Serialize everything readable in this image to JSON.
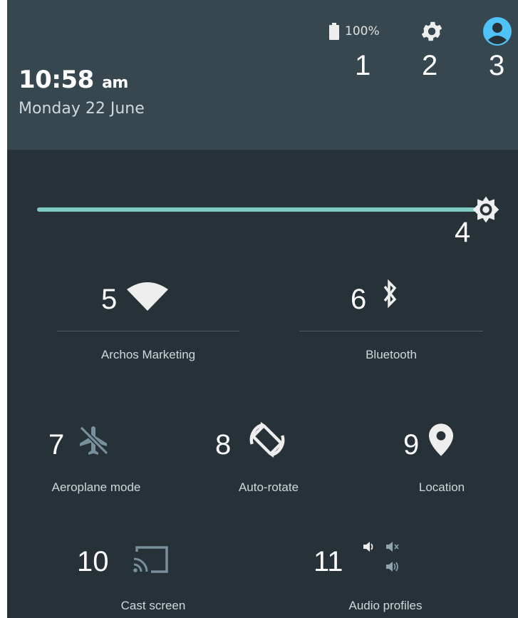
{
  "status": {
    "time": "10:58",
    "ampm": "am",
    "date": "Monday 22 June",
    "battery_percent": "100%"
  },
  "brightness": {
    "level": 1.0
  },
  "tiles": [
    {
      "label": "Archos Marketing",
      "icon": "wifi-icon"
    },
    {
      "label": "Bluetooth",
      "icon": "bluetooth-icon"
    },
    {
      "label": "Aeroplane mode",
      "icon": "airplane-icon"
    },
    {
      "label": "Auto-rotate",
      "icon": "rotate-icon"
    },
    {
      "label": "Location",
      "icon": "location-pin-icon"
    },
    {
      "label": "Cast screen",
      "icon": "cast-icon"
    },
    {
      "label": "Audio profiles",
      "icon": "speaker-icon"
    }
  ],
  "callouts": [
    "1",
    "2",
    "3",
    "4",
    "5",
    "6",
    "7",
    "8",
    "9",
    "10",
    "11"
  ],
  "colors": {
    "header_bg": "#37474f",
    "panel_bg": "#263238",
    "accent": "#80cbc4",
    "avatar": "#4fc3f7"
  }
}
